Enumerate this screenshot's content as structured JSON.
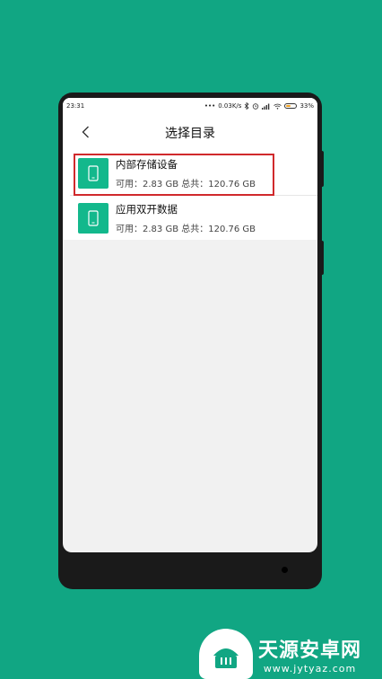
{
  "status_bar": {
    "time": "23:31",
    "network_speed": "0.03K/s",
    "battery_percent": "33%"
  },
  "header": {
    "title": "选择目录"
  },
  "storage_items": [
    {
      "name": "内部存储设备",
      "detail": "可用：2.83 GB 总共：120.76 GB",
      "icon": "phone-icon",
      "highlighted": true
    },
    {
      "name": "应用双开数据",
      "detail": "可用：2.83 GB 总共：120.76 GB",
      "icon": "phone-icon",
      "highlighted": false
    }
  ],
  "colors": {
    "background": "#11a683",
    "icon_tile": "#13b88c",
    "highlight_border": "#d0292c"
  },
  "watermark": {
    "name": "天源安卓网",
    "url": "www.jytyaz.com"
  }
}
